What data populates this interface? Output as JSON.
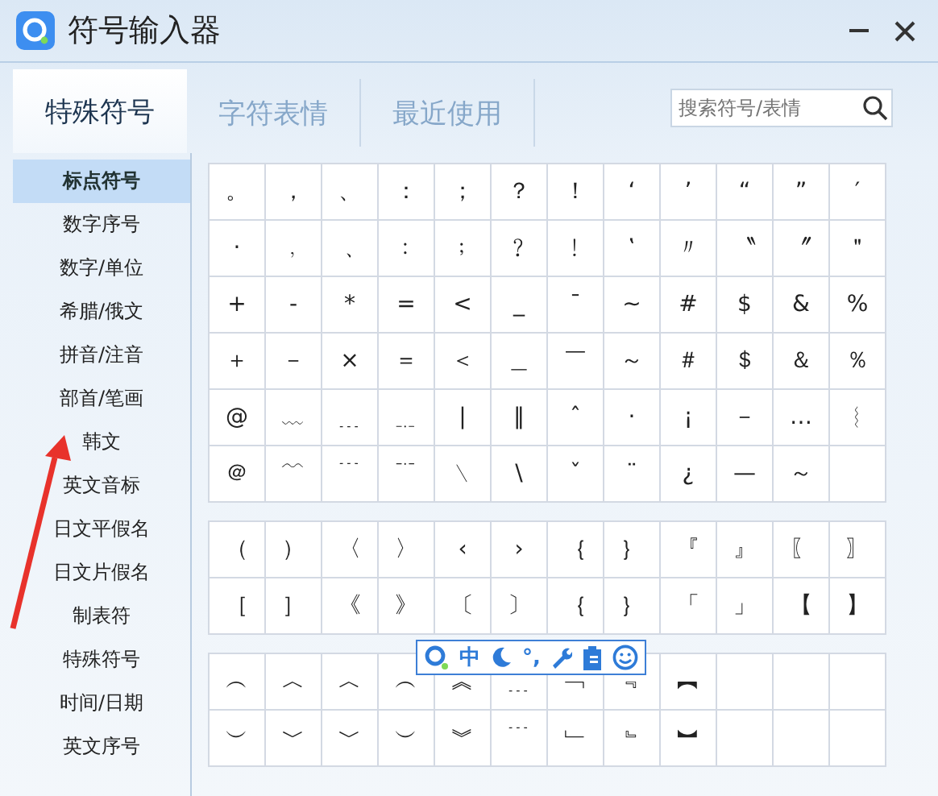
{
  "window": {
    "title": "符号输入器"
  },
  "tabs": [
    {
      "label": "特殊符号",
      "selected": true
    },
    {
      "label": "字符表情",
      "selected": false
    },
    {
      "label": "最近使用",
      "selected": false
    }
  ],
  "search": {
    "placeholder": "搜索符号/表情"
  },
  "sidebar": {
    "items": [
      {
        "label": "标点符号",
        "selected": true
      },
      {
        "label": "数字序号",
        "selected": false
      },
      {
        "label": "数字/单位",
        "selected": false
      },
      {
        "label": "希腊/俄文",
        "selected": false
      },
      {
        "label": "拼音/注音",
        "selected": false
      },
      {
        "label": "部首/笔画",
        "selected": false
      },
      {
        "label": "韩文",
        "selected": false
      },
      {
        "label": "英文音标",
        "selected": false
      },
      {
        "label": "日文平假名",
        "selected": false
      },
      {
        "label": "日文片假名",
        "selected": false
      },
      {
        "label": "制表符",
        "selected": false
      },
      {
        "label": "特殊符号",
        "selected": false
      },
      {
        "label": "时间/日期",
        "selected": false
      },
      {
        "label": "英文序号",
        "selected": false
      }
    ]
  },
  "symbol_groups": [
    {
      "rows": [
        [
          "。",
          "，",
          "、",
          "：",
          "；",
          "？",
          "！",
          "‘",
          "’",
          "“",
          "”",
          "′"
        ],
        [
          "·",
          "﹐",
          "﹑",
          "﹕",
          "﹔",
          "﹖",
          "﹗",
          "‛",
          "〃",
          "〝",
          "〞",
          "＂"
        ],
        [
          "+",
          "-",
          "*",
          "=",
          "<",
          "_",
          "¯",
          "~",
          "#",
          "$",
          "&",
          "%"
        ],
        [
          "＋",
          "－",
          "×",
          "＝",
          "＜",
          "＿",
          "￣",
          "～",
          "＃",
          "＄",
          "＆",
          "％"
        ],
        [
          "@",
          "﹏",
          "﹍",
          "﹎",
          "|",
          "‖",
          "ˆ",
          "·",
          "¡",
          "－",
          "…",
          "︴"
        ],
        [
          "＠",
          "﹋",
          "﹉",
          "﹊",
          "﹨",
          "\\",
          "ˇ",
          "¨",
          "¿",
          "—",
          "～"
        ]
      ]
    },
    {
      "rows": [
        [
          "（",
          "）",
          "〈",
          "〉",
          "‹",
          "›",
          "｛",
          "｝",
          "『",
          "』",
          "〖",
          "〗"
        ],
        [
          "［",
          "］",
          "《",
          "》",
          "〔",
          "〕",
          "｛",
          "｝",
          "「",
          "」",
          "【",
          "】"
        ]
      ]
    },
    {
      "rows": [
        [
          "︵",
          "︿",
          "︿",
          "︵",
          "︽",
          "﹍",
          "﹁",
          "﹃",
          "︻"
        ],
        [
          "︶",
          "﹀",
          "﹀",
          "︶",
          "︾",
          "﹉",
          "﹂",
          "﹄",
          "︼"
        ]
      ]
    }
  ],
  "floating_toolbar": {
    "mode": "中",
    "punctuation": "°,"
  }
}
